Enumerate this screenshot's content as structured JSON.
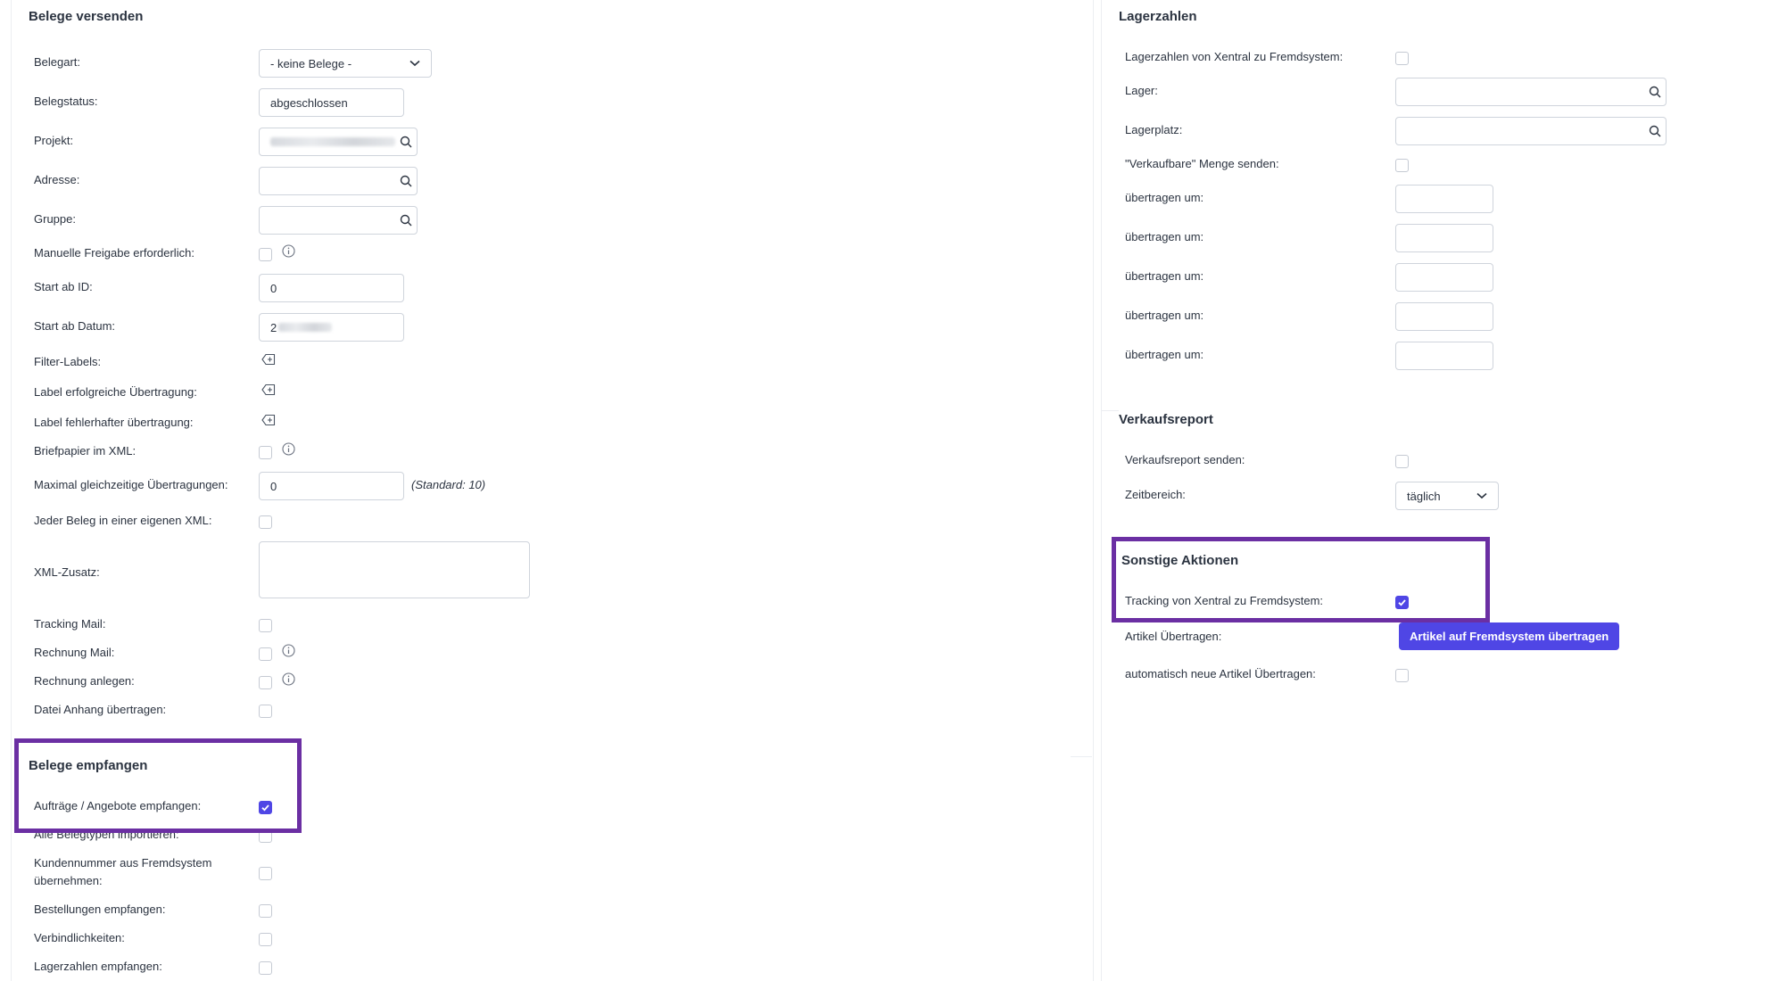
{
  "send": {
    "title": "Belege versenden",
    "belegart_label": "Belegart:",
    "belegart_value": "- keine Belege -",
    "belegstatus_label": "Belegstatus:",
    "belegstatus_value": "abgeschlossen",
    "projekt_label": "Projekt:",
    "adresse_label": "Adresse:",
    "gruppe_label": "Gruppe:",
    "manuelle_label": "Manuelle Freigabe erforderlich:",
    "start_id_label": "Start ab ID:",
    "start_id_value": "0",
    "start_datum_label": "Start ab Datum:",
    "start_datum_value": "2",
    "filter_labels_label": "Filter-Labels:",
    "label_erfolg_label": "Label erfolgreiche Übertragung:",
    "label_fehler_label": "Label fehlerhafter übertragung:",
    "briefpapier_label": "Briefpapier im XML:",
    "max_label": "Maximal gleichzeitige Übertragungen:",
    "max_value": "0",
    "max_note": "(Standard: 10)",
    "jeder_label": "Jeder Beleg in einer eigenen XML:",
    "xml_zusatz_label": "XML-Zusatz:",
    "tracking_mail_label": "Tracking Mail:",
    "rechnung_mail_label": "Rechnung Mail:",
    "rechnung_anlegen_label": "Rechnung anlegen:",
    "datei_anhang_label": "Datei Anhang übertragen:"
  },
  "receive": {
    "title": "Belege empfangen",
    "auftraege_label": "Aufträge / Angebote empfangen:",
    "alle_label": "Alle Belegtypen importieren:",
    "kunden_line1": "Kundennummer aus Fremdsystem",
    "kunden_line2": "übernehmen:",
    "bestellungen_label": "Bestellungen empfangen:",
    "verbindlichkeiten_label": "Verbindlichkeiten:",
    "lagerzahlen_label": "Lagerzahlen empfangen:"
  },
  "stock": {
    "title": "Lagerzahlen",
    "xentral_label": "Lagerzahlen von Xentral zu Fremdsystem:",
    "lager_label": "Lager:",
    "lagerplatz_label": "Lagerplatz:",
    "verkaufbare_label": "\"Verkaufbare\" Menge senden:",
    "uebertragen_label": "übertragen um:"
  },
  "report": {
    "title": "Verkaufsreport",
    "senden_label": "Verkaufsreport senden:",
    "zeitbereich_label": "Zeitbereich:",
    "zeitbereich_value": "täglich"
  },
  "actions": {
    "title": "Sonstige Aktionen",
    "tracking_label": "Tracking von Xentral zu Fremdsystem:",
    "artikel_label": "Artikel Übertragen:",
    "artikel_button": "Artikel auf Fremdsystem übertragen",
    "auto_label": "automatisch neue Artikel Übertragen:"
  },
  "colors": {
    "accent": "#4f46e5",
    "highlight": "#6b2fa3"
  }
}
